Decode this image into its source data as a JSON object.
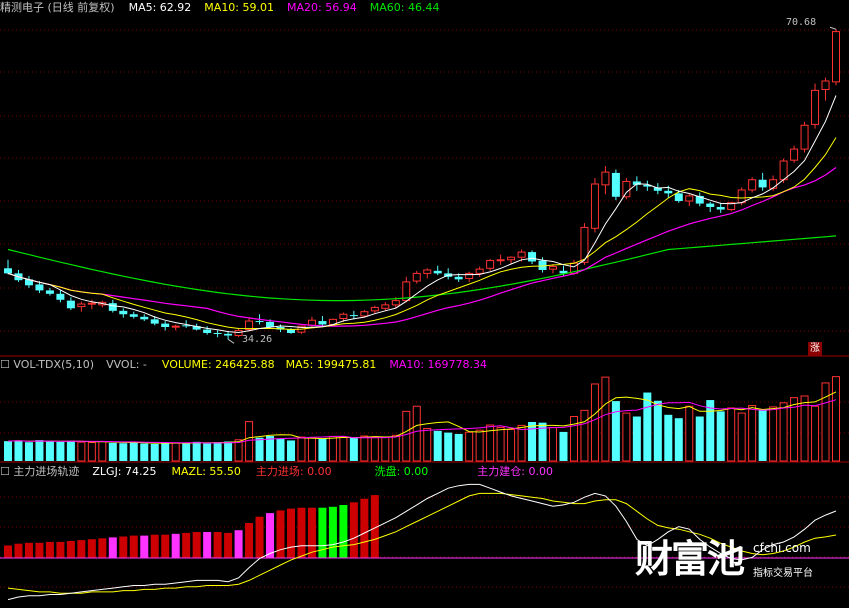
{
  "price_panel": {
    "title": "精测电子 (日线 前复权)",
    "ma5_label": "MA5: 62.92",
    "ma10_label": "MA10: 59.01",
    "ma20_label": "MA20: 56.94",
    "ma60_label": "MA60: 46.44",
    "high_label": "70.68",
    "low_label": "34.26",
    "zhang_badge": "涨"
  },
  "volume_panel": {
    "title": "VOL-TDX(5,10)",
    "vvol_label": "VVOL: -",
    "volume_label": "VOLUME: 246425.88",
    "ma5_label": "MA5: 199475.81",
    "ma10_label": "MA10: 169778.34"
  },
  "indicator_panel": {
    "title": "主力进场轨迹",
    "zlgj_label": "ZLGJ: 74.25",
    "mazl_label": "MAZL: 55.50",
    "enter_label": "主力进场: 0.00",
    "wash_label": "洗盘: 0.00",
    "build_label": "主力建仓: 0.00"
  },
  "watermark": {
    "brand": "财富池",
    "site": "cfchi.com",
    "tagline": "指标交易平台"
  },
  "colors": {
    "up": "#ff3232",
    "down": "#54ffff",
    "ma5": "#ffffff",
    "ma10": "#ffff00",
    "ma20": "#ff00ff",
    "ma60": "#00e600",
    "grid": "#7a0000",
    "enter_bar": "#cc0000",
    "wash_bar": "#ff33ff",
    "build_bar": "#00ff00",
    "zlgj_line": "#ffffff",
    "mazl_line": "#ffff00"
  },
  "chart_data": [
    {
      "type": "candlestick",
      "title": "精测电子 (日线 前复权)",
      "ylim": [
        33,
        72
      ],
      "high_marker": 70.68,
      "low_marker": 34.26,
      "ohlc": [
        [
          42.6,
          43.6,
          41.9,
          42.0
        ],
        [
          42.0,
          42.4,
          41.0,
          41.2
        ],
        [
          41.3,
          41.7,
          40.3,
          40.6
        ],
        [
          40.7,
          41.1,
          39.7,
          40.0
        ],
        [
          40.0,
          40.3,
          39.4,
          39.6
        ],
        [
          39.6,
          40.1,
          38.6,
          38.9
        ],
        [
          38.8,
          39.2,
          37.7,
          37.9
        ],
        [
          38.1,
          38.7,
          37.5,
          38.4
        ],
        [
          38.4,
          38.9,
          37.8,
          38.5
        ],
        [
          38.3,
          38.8,
          38.0,
          38.6
        ],
        [
          38.5,
          38.9,
          37.4,
          37.6
        ],
        [
          37.6,
          37.9,
          36.8,
          37.2
        ],
        [
          37.2,
          37.5,
          36.7,
          36.9
        ],
        [
          36.9,
          37.2,
          36.4,
          36.6
        ],
        [
          36.6,
          37.0,
          35.9,
          36.1
        ],
        [
          36.1,
          36.4,
          35.3,
          35.7
        ],
        [
          35.7,
          36.0,
          35.3,
          35.8
        ],
        [
          35.9,
          36.5,
          35.6,
          35.8
        ],
        [
          35.8,
          36.1,
          35.3,
          35.4
        ],
        [
          35.4,
          35.8,
          34.8,
          35.0
        ],
        [
          35.0,
          35.3,
          34.5,
          34.9
        ],
        [
          34.9,
          35.2,
          34.26,
          34.7
        ],
        [
          34.7,
          35.6,
          34.5,
          35.3
        ],
        [
          35.4,
          36.7,
          35.2,
          36.4
        ],
        [
          36.4,
          37.2,
          36.0,
          36.3
        ],
        [
          36.3,
          36.6,
          35.5,
          35.7
        ],
        [
          35.7,
          36.0,
          35.1,
          35.4
        ],
        [
          35.4,
          35.6,
          34.9,
          35.0
        ],
        [
          35.1,
          35.9,
          34.9,
          35.8
        ],
        [
          35.9,
          36.9,
          35.7,
          36.5
        ],
        [
          36.4,
          37.0,
          35.8,
          36.0
        ],
        [
          36.0,
          36.7,
          35.8,
          36.6
        ],
        [
          36.7,
          37.4,
          36.3,
          37.2
        ],
        [
          37.1,
          37.6,
          36.6,
          37.0
        ],
        [
          37.0,
          37.7,
          36.8,
          37.5
        ],
        [
          37.6,
          38.2,
          37.3,
          38.0
        ],
        [
          37.9,
          38.6,
          37.6,
          38.3
        ],
        [
          38.3,
          39.2,
          37.9,
          38.8
        ],
        [
          38.8,
          41.6,
          38.6,
          41.0
        ],
        [
          41.1,
          42.3,
          40.8,
          42.0
        ],
        [
          42.0,
          42.6,
          41.4,
          42.4
        ],
        [
          42.3,
          42.9,
          41.8,
          42.0
        ],
        [
          42.0,
          42.6,
          41.3,
          41.6
        ],
        [
          41.6,
          42.0,
          41.0,
          41.3
        ],
        [
          41.4,
          42.2,
          41.0,
          42.0
        ],
        [
          42.0,
          42.8,
          41.6,
          42.5
        ],
        [
          42.6,
          43.7,
          42.3,
          43.5
        ],
        [
          43.5,
          44.2,
          43.0,
          43.6
        ],
        [
          43.6,
          44.0,
          43.1,
          43.9
        ],
        [
          43.9,
          44.8,
          43.4,
          44.5
        ],
        [
          44.5,
          44.7,
          43.1,
          43.4
        ],
        [
          43.5,
          43.9,
          42.1,
          42.4
        ],
        [
          42.5,
          43.1,
          42.0,
          42.8
        ],
        [
          42.3,
          42.9,
          41.7,
          42.0
        ],
        [
          42.0,
          43.6,
          41.8,
          43.2
        ],
        [
          43.3,
          47.9,
          43.0,
          47.4
        ],
        [
          47.3,
          53.2,
          46.8,
          52.5
        ],
        [
          52.4,
          54.6,
          51.3,
          53.9
        ],
        [
          53.8,
          54.2,
          50.6,
          51.0
        ],
        [
          51.0,
          53.2,
          50.7,
          52.8
        ],
        [
          52.8,
          53.4,
          51.7,
          52.4
        ],
        [
          52.4,
          52.9,
          51.7,
          52.2
        ],
        [
          52.1,
          52.6,
          51.3,
          51.7
        ],
        [
          51.7,
          52.3,
          50.9,
          51.4
        ],
        [
          51.4,
          51.8,
          50.3,
          50.5
        ],
        [
          50.5,
          51.3,
          49.9,
          51.1
        ],
        [
          51.1,
          51.5,
          49.9,
          50.2
        ],
        [
          50.2,
          50.4,
          49.2,
          49.8
        ],
        [
          49.8,
          50.3,
          49.1,
          49.5
        ],
        [
          49.5,
          50.4,
          49.3,
          50.3
        ],
        [
          50.3,
          52.1,
          50.0,
          51.8
        ],
        [
          51.8,
          53.3,
          51.5,
          53.0
        ],
        [
          53.0,
          53.8,
          51.7,
          52.1
        ],
        [
          52.0,
          53.5,
          51.7,
          53.0
        ],
        [
          53.0,
          55.5,
          52.6,
          55.2
        ],
        [
          55.3,
          57.0,
          55.0,
          56.6
        ],
        [
          56.6,
          59.8,
          56.2,
          59.4
        ],
        [
          59.5,
          64.3,
          59.0,
          63.5
        ],
        [
          63.6,
          65.0,
          62.3,
          64.6
        ],
        [
          64.5,
          70.68,
          64.1,
          70.4
        ]
      ]
    },
    {
      "type": "bar",
      "title": "VOL-TDX(5,10)",
      "ylim": [
        0,
        260000
      ],
      "values": [
        58000,
        60000,
        55000,
        61000,
        57000,
        56000,
        59000,
        55000,
        54000,
        57000,
        53000,
        52000,
        55000,
        51000,
        50000,
        54000,
        53000,
        52000,
        56000,
        51000,
        55000,
        57000,
        62000,
        115000,
        68000,
        73000,
        65000,
        60000,
        70000,
        67000,
        65000,
        72000,
        70000,
        68000,
        73000,
        71000,
        69000,
        75000,
        145000,
        160000,
        95000,
        88000,
        83000,
        79000,
        84000,
        90000,
        105000,
        98000,
        92000,
        104000,
        114000,
        112000,
        98000,
        85000,
        130000,
        148000,
        225000,
        245000,
        175000,
        140000,
        130000,
        200000,
        176000,
        135000,
        125000,
        160000,
        130000,
        178000,
        145000,
        155000,
        140000,
        162000,
        150000,
        158000,
        170000,
        185000,
        190000,
        160000,
        228000,
        246425.88
      ],
      "ma5_value": 199475.81,
      "ma10_value": 169778.34
    },
    {
      "type": "bar_line",
      "title": "主力进场轨迹",
      "ylim": [
        0,
        100
      ],
      "zlgj": [
        5,
        7,
        8,
        8,
        9,
        9,
        10,
        11,
        12,
        13,
        14,
        15,
        16,
        16,
        17,
        17,
        18,
        19,
        20,
        20,
        20,
        19,
        22,
        30,
        37,
        41,
        44,
        46,
        47,
        47,
        47,
        48,
        50,
        53,
        57,
        61,
        65,
        69,
        74,
        79,
        84,
        88,
        92,
        94,
        95,
        95,
        92,
        89,
        86,
        84,
        82,
        80,
        78,
        79,
        81,
        85,
        88,
        86,
        78,
        66,
        52,
        47,
        52,
        58,
        62,
        60,
        52,
        46,
        41,
        37,
        36,
        38,
        44,
        48,
        50,
        54,
        60,
        67,
        71,
        74.25
      ],
      "mazl": [
        14,
        13,
        12,
        11,
        11,
        10,
        10,
        10,
        11,
        11,
        11,
        12,
        12,
        13,
        13,
        14,
        14,
        15,
        15,
        16,
        16,
        16,
        17,
        20,
        24,
        28,
        32,
        36,
        39,
        42,
        44,
        46,
        47,
        48,
        50,
        52,
        55,
        58,
        62,
        66,
        70,
        74,
        78,
        82,
        86,
        88,
        88,
        88,
        87,
        86,
        85,
        84,
        82,
        81,
        80,
        80,
        82,
        83,
        83,
        80,
        74,
        68,
        63,
        61,
        60,
        58,
        56,
        53,
        49,
        46,
        43,
        41,
        40,
        41,
        43,
        46,
        50,
        53,
        54,
        55.5
      ],
      "enter": [
        0,
        0,
        0,
        0,
        0,
        0,
        0,
        0,
        0,
        0,
        0,
        0,
        0,
        0,
        0,
        0,
        0,
        0,
        0,
        0,
        0,
        0,
        0,
        0,
        0,
        0,
        0,
        0,
        0,
        0,
        0,
        0,
        0,
        0,
        0,
        0,
        0,
        0,
        0,
        0,
        0,
        0,
        0,
        0,
        0,
        0,
        0,
        0,
        0,
        0,
        0,
        0,
        0,
        0,
        0,
        0,
        0,
        0,
        0,
        0,
        0,
        0,
        0,
        0,
        0,
        0,
        0,
        0,
        0,
        0,
        0,
        0,
        0,
        0,
        0,
        0,
        0,
        0,
        0,
        0
      ],
      "wash": [
        0,
        0,
        0,
        0,
        0,
        0,
        0,
        0,
        0,
        0,
        0,
        0,
        0,
        0,
        0,
        0,
        0,
        0,
        0,
        0,
        0,
        0,
        0,
        0,
        0,
        0,
        0,
        0,
        0,
        0,
        0,
        0,
        0,
        0,
        0,
        0,
        0,
        0,
        0,
        0,
        0,
        0,
        0,
        0,
        0,
        0,
        0,
        0,
        0,
        0,
        0,
        0,
        0,
        0,
        0,
        0,
        0,
        0,
        0,
        0,
        0,
        0,
        0,
        0,
        0,
        0,
        0,
        0,
        0,
        0,
        0,
        0,
        0,
        0,
        0,
        0,
        0,
        0,
        0,
        0
      ],
      "build": [
        0,
        0,
        0,
        0,
        0,
        0,
        0,
        0,
        0,
        0,
        0,
        0,
        0,
        0,
        0,
        0,
        0,
        0,
        0,
        0,
        0,
        0,
        0,
        0,
        0,
        0,
        0,
        0,
        0,
        0,
        0,
        0,
        0,
        0,
        0,
        0,
        0,
        0,
        0,
        0,
        0,
        0,
        0,
        0,
        0,
        0,
        0,
        0,
        0,
        0,
        0,
        0,
        0,
        0,
        0,
        0,
        0,
        0,
        0,
        0,
        0,
        0,
        0,
        0,
        0,
        0,
        0,
        0,
        0,
        0,
        0,
        0,
        0,
        0,
        0,
        0,
        0,
        0,
        0,
        0
      ]
    }
  ]
}
